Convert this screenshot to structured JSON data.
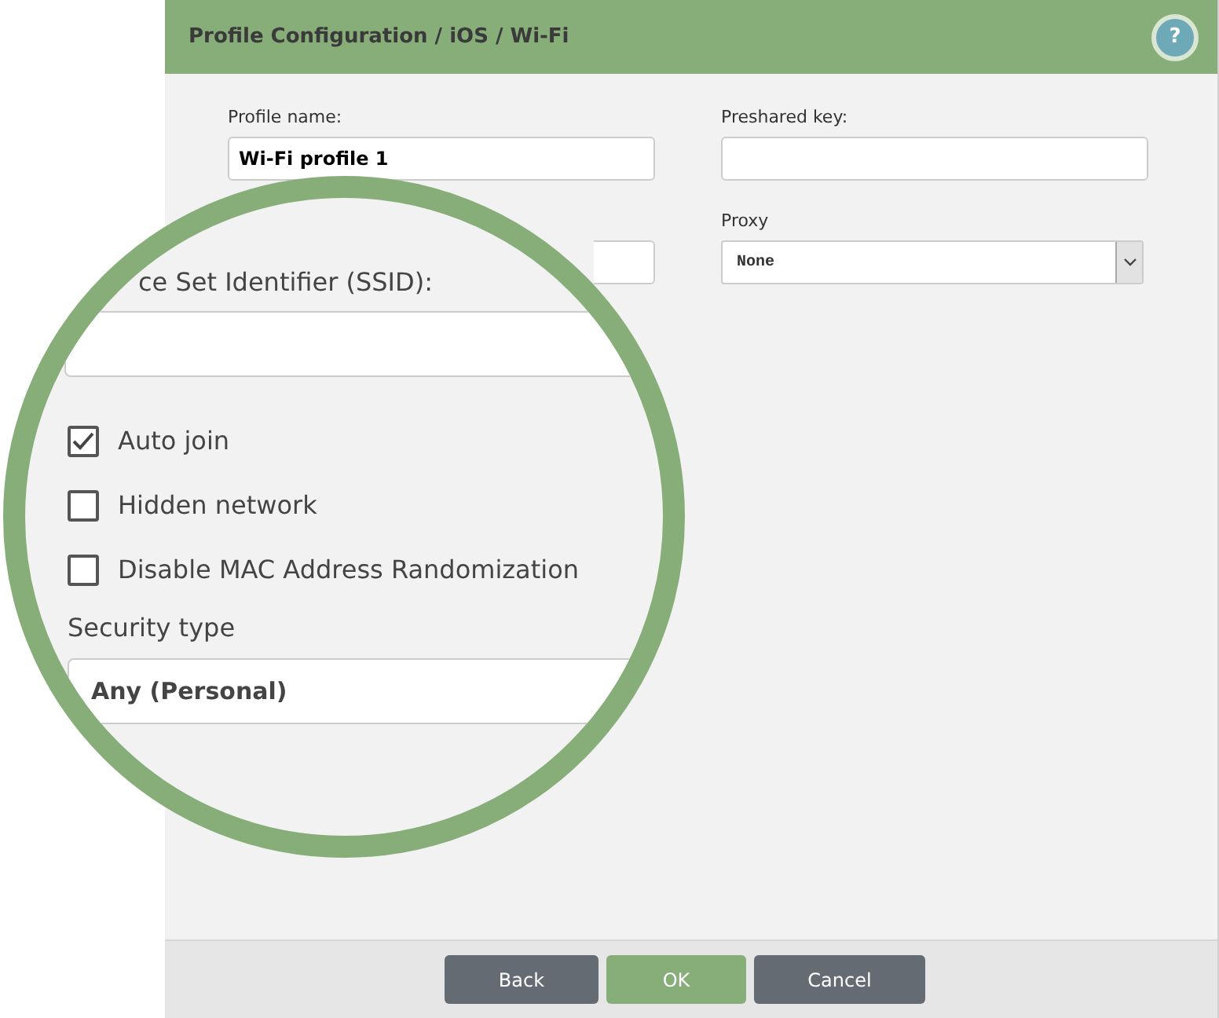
{
  "dialog": {
    "title": "Profile Configuration / iOS / Wi-Fi",
    "help_button": "?"
  },
  "left_column": [
    {
      "kind": "text",
      "label": "Profile name:",
      "value": "Wi-Fi profile 1"
    },
    {
      "kind": "text"
    }
  ],
  "right_column": [
    {
      "kind": "text",
      "label": "Preshared key:"
    },
    {
      "kind": "select",
      "label": "Proxy",
      "value": "None"
    }
  ],
  "magnifier": {
    "items": [
      {
        "kind": "label",
        "text": "ce Set Identifier (SSID):"
      },
      {
        "kind": "text"
      },
      {
        "kind": "checkbox",
        "label": "Auto join",
        "checked": true
      },
      {
        "kind": "checkbox",
        "label": "Hidden network",
        "checked": false
      },
      {
        "kind": "checkbox",
        "label": "Disable MAC Address Randomization",
        "checked": false
      },
      {
        "kind": "label",
        "text": "Security type"
      },
      {
        "kind": "select",
        "value": "Any (Personal)"
      }
    ]
  },
  "buttons": [
    {
      "label": "Back",
      "kind": "secondary"
    },
    {
      "label": "OK",
      "kind": "primary"
    },
    {
      "label": "Cancel",
      "kind": "secondary"
    }
  ]
}
